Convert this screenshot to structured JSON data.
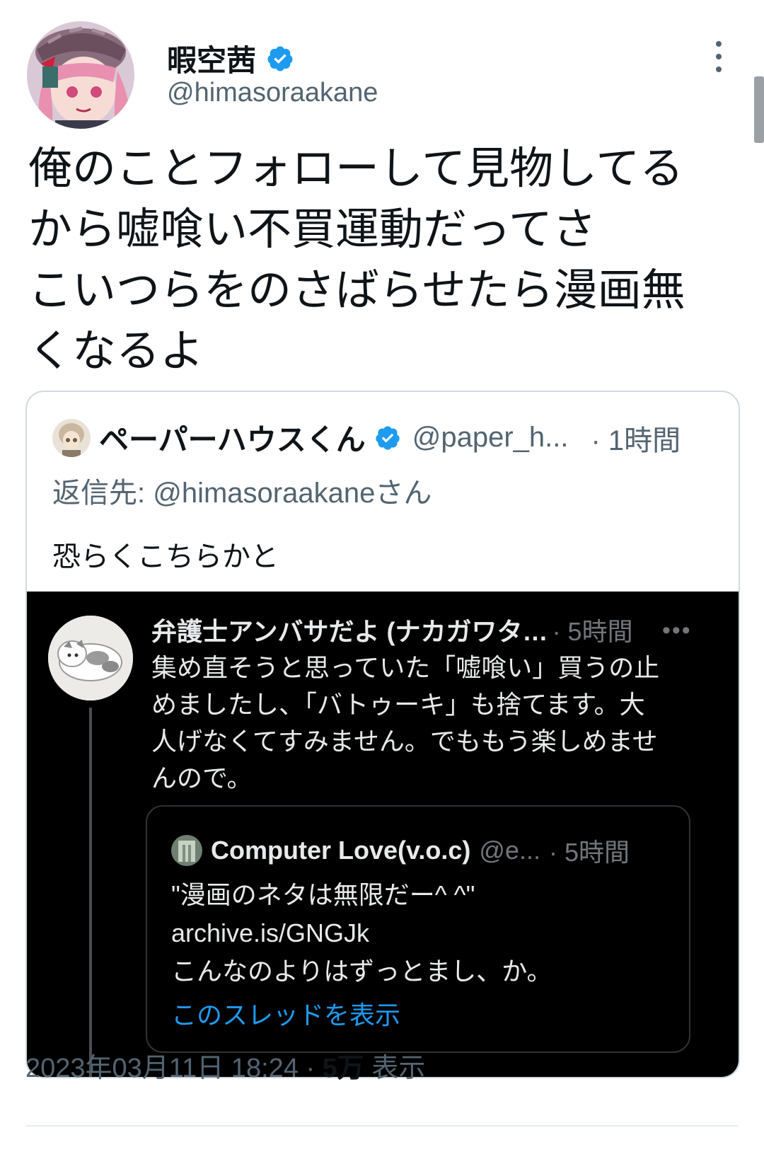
{
  "author": {
    "display_name": "暇空茜",
    "handle": "@himasoraakane",
    "verified": true,
    "verified_icon": "verified-badge-icon"
  },
  "tweet": {
    "lines": [
      "俺のことフォローして見物してる",
      "から嘘喰い不買運動だってさ",
      "こいつらをのさばらせたら漫画無",
      "くなるよ"
    ]
  },
  "quoted": {
    "display_name": "ペーパーハウスくん",
    "handle": "@paper_h...",
    "time": "· 1時間",
    "reply_to": "返信先: @himasoraakaneさん",
    "text": "恐らくこちらかと",
    "screenshot": {
      "name": "弁護士アンバサだよ (ナカガワタ…",
      "time": "· 5時間",
      "more": "•••",
      "body_lines": [
        "集め直そうと思っていた「嘘喰い」買うの止",
        "めましたし、「バトゥーキ」も捨てます。大",
        "人げなくてすみません。でももう楽しめませ",
        "んので。"
      ],
      "inner": {
        "name": "Computer Love(v.o.c)",
        "handle": "@e...",
        "time": "· 5時間",
        "body_lines": [
          "\"漫画のネタは無限だー^ ^\"",
          "archive.is/GNGJk",
          "こんなのよりはずっとまし、か。"
        ],
        "link": "このスレッドを表示"
      }
    }
  },
  "footer": {
    "datetime": "2023年03月11日 18:24 · ",
    "views_count": "5万",
    "views_label": " 表示"
  },
  "colors": {
    "accent": "#1d9bf0",
    "text": "#0f1419",
    "secondary": "#536471",
    "dark_bg": "#000000"
  }
}
